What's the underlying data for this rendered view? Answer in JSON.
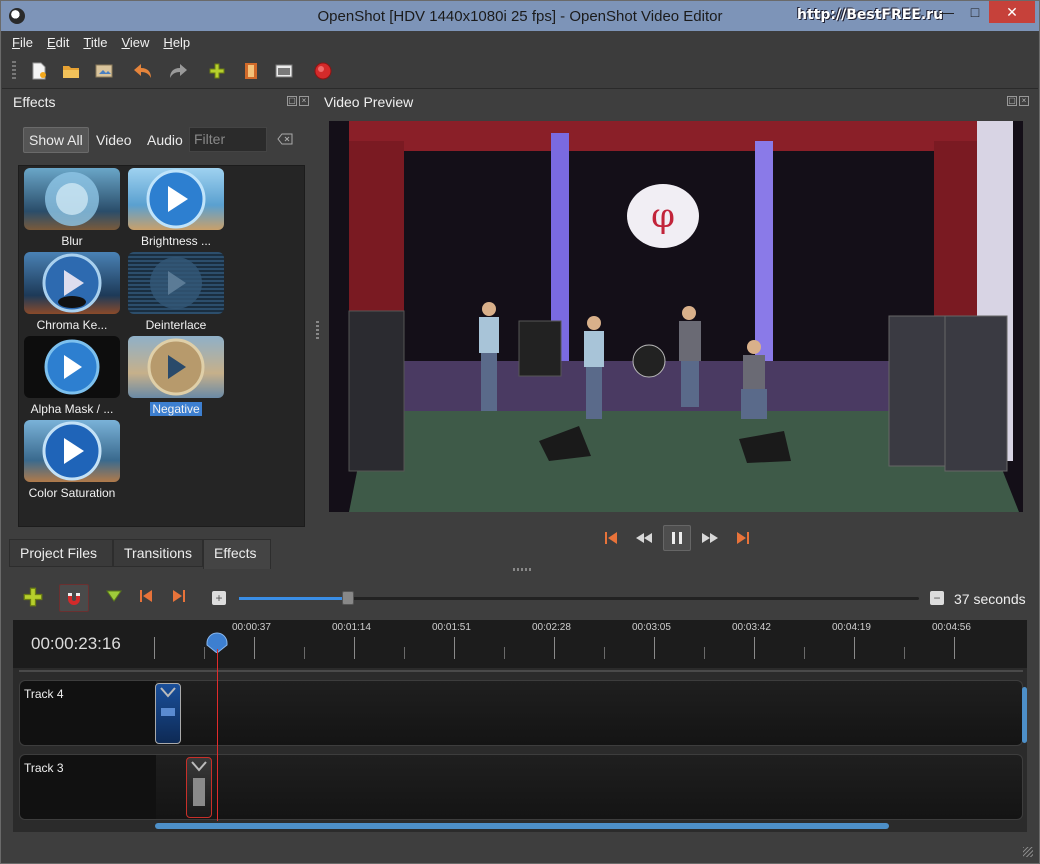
{
  "window": {
    "title": "OpenShot [HDV 1440x1080i 25 fps] - OpenShot Video Editor",
    "watermark": "http://BestFREE.ru",
    "minimize_glyph": "—",
    "maximize_glyph": "□",
    "close_glyph": "✕"
  },
  "menu": [
    {
      "key": "F",
      "rest": "ile"
    },
    {
      "key": "E",
      "rest": "dit"
    },
    {
      "key": "T",
      "rest": "itle"
    },
    {
      "key": "V",
      "rest": "iew"
    },
    {
      "key": "H",
      "rest": "elp"
    }
  ],
  "toolbar": {
    "icons": [
      "new-project-icon",
      "open-project-icon",
      "save-project-icon",
      "undo-icon",
      "redo-icon",
      "import-files-icon",
      "profile-icon",
      "fullscreen-icon",
      "export-video-icon"
    ]
  },
  "effects_panel": {
    "title": "Effects",
    "filters": {
      "show_all": "Show All",
      "video": "Video",
      "audio": "Audio"
    },
    "filter_placeholder": "Filter",
    "items": [
      {
        "label": "Blur"
      },
      {
        "label": "Brightness ..."
      },
      {
        "label": "Chroma Ke..."
      },
      {
        "label": "Deinterlace"
      },
      {
        "label": "Alpha Mask / ..."
      },
      {
        "label": "Negative",
        "selected": true
      },
      {
        "label": "Color Saturation"
      }
    ]
  },
  "panel_tabs": {
    "project_files": "Project Files",
    "transitions": "Transitions",
    "effects": "Effects",
    "active": "Effects"
  },
  "preview": {
    "title": "Video Preview",
    "controls": [
      "jump-start-icon",
      "rewind-icon",
      "pause-icon",
      "fast-forward-icon",
      "jump-end-icon"
    ]
  },
  "timeline": {
    "zoom_label": "37 seconds",
    "zoom_level": 0.16,
    "current_time": "00:00:23:16",
    "ruler_labels": [
      "00:00:37",
      "00:01:14",
      "00:01:51",
      "00:02:28",
      "00:03:05",
      "00:03:42",
      "00:04:19",
      "00:04:56"
    ],
    "tracks": [
      {
        "name": "Track 4"
      },
      {
        "name": "Track 3"
      }
    ]
  },
  "colors": {
    "accent": "#3a8ee6",
    "playhead": "#e02b2b",
    "selection": "#3d7fd0"
  }
}
